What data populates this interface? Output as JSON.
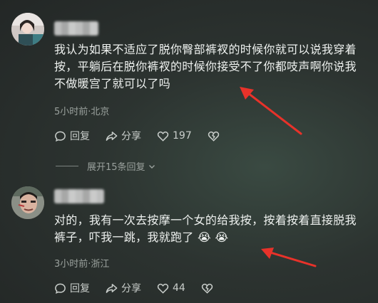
{
  "comments": [
    {
      "text": "我认为如果不适应了脱你臀部裤衩的时候你就可以说我穿着按，平躺后在脱你裤衩的时候你接受不了你都吱声啊你说我不做暖宫了就可以了吗",
      "meta": "5小时前·北京",
      "reply_label": "回复",
      "share_label": "分享",
      "like_count": "197"
    },
    {
      "text": "对的，我有一次去按摩一个女的给我按，按着按着直接脱我裤子，吓我一跳，我就跑了 😭 😭",
      "meta": "3小时前·浙江",
      "reply_label": "回复",
      "share_label": "分享",
      "like_count": "44"
    }
  ],
  "expand_replies": "展开15条回复",
  "icons": {
    "reply": "comment-bubble-icon",
    "share": "share-arrow-icon",
    "like": "heart-icon",
    "dislike": "broken-heart-icon",
    "expand": "chevron-down-icon"
  },
  "colors": {
    "annotation_arrow": "#e8322a"
  }
}
